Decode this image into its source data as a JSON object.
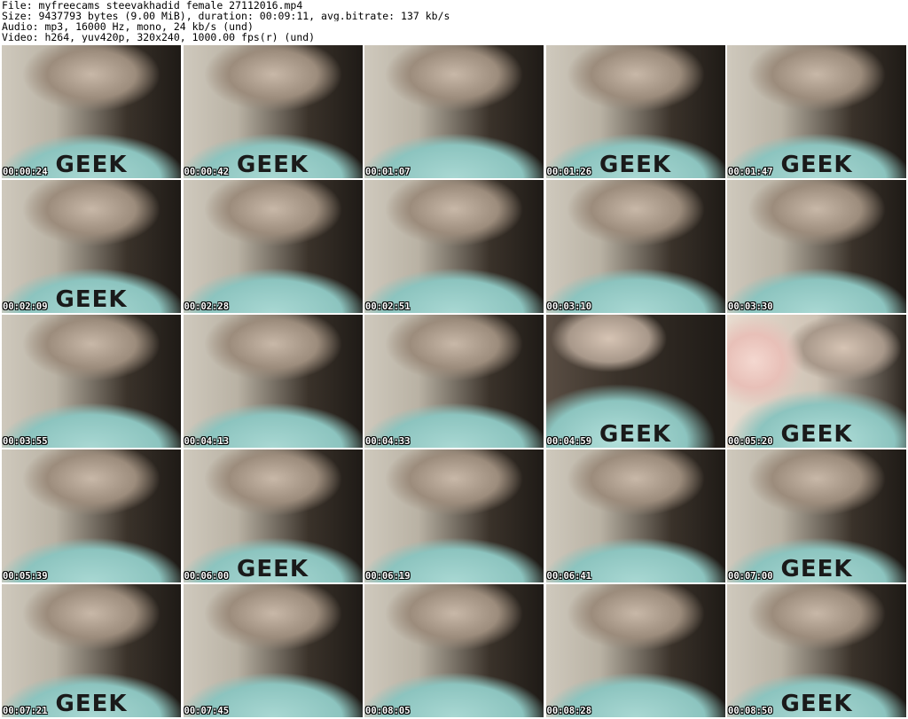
{
  "header": {
    "file_line": "File: myfreecams_steevakhadid_female_27112016.mp4",
    "size_line": "Size: 9437793 bytes (9.00 MiB), duration: 00:09:11, avg.bitrate: 137 kb/s",
    "audio_line": "Audio: mp3, 16000 Hz, mono, 24 kb/s (und)",
    "video_line": "Video: h264, yuv420p, 320x240, 1000.00 fps(r) (und)"
  },
  "thumbnails": [
    {
      "timestamp": "00:00:24",
      "shirt": "GEEK",
      "style": "normal"
    },
    {
      "timestamp": "00:00:42",
      "shirt": "GEEK",
      "style": "normal"
    },
    {
      "timestamp": "00:01:07",
      "shirt": "",
      "style": "normal"
    },
    {
      "timestamp": "00:01:26",
      "shirt": "GEEK",
      "style": "normal"
    },
    {
      "timestamp": "00:01:47",
      "shirt": "GEEK",
      "style": "normal"
    },
    {
      "timestamp": "00:02:09",
      "shirt": "GEEK",
      "style": "normal"
    },
    {
      "timestamp": "00:02:28",
      "shirt": "",
      "style": "normal"
    },
    {
      "timestamp": "00:02:51",
      "shirt": "",
      "style": "normal"
    },
    {
      "timestamp": "00:03:10",
      "shirt": "",
      "style": "normal"
    },
    {
      "timestamp": "00:03:30",
      "shirt": "",
      "style": "normal"
    },
    {
      "timestamp": "00:03:55",
      "shirt": "",
      "style": "normal"
    },
    {
      "timestamp": "00:04:13",
      "shirt": "",
      "style": "normal"
    },
    {
      "timestamp": "00:04:33",
      "shirt": "",
      "style": "normal"
    },
    {
      "timestamp": "00:04:59",
      "shirt": "GEEK",
      "style": "alt"
    },
    {
      "timestamp": "00:05:20",
      "shirt": "GEEK",
      "style": "blur"
    },
    {
      "timestamp": "00:05:39",
      "shirt": "",
      "style": "normal"
    },
    {
      "timestamp": "00:06:00",
      "shirt": "GEEK",
      "style": "normal"
    },
    {
      "timestamp": "00:06:19",
      "shirt": "",
      "style": "normal"
    },
    {
      "timestamp": "00:06:41",
      "shirt": "",
      "style": "normal"
    },
    {
      "timestamp": "00:07:00",
      "shirt": "GEEK",
      "style": "normal"
    },
    {
      "timestamp": "00:07:21",
      "shirt": "GEEK",
      "style": "normal"
    },
    {
      "timestamp": "00:07:45",
      "shirt": "",
      "style": "normal"
    },
    {
      "timestamp": "00:08:05",
      "shirt": "",
      "style": "normal"
    },
    {
      "timestamp": "00:08:28",
      "shirt": "",
      "style": "normal"
    },
    {
      "timestamp": "00:08:50",
      "shirt": "GEEK",
      "style": "normal"
    }
  ]
}
